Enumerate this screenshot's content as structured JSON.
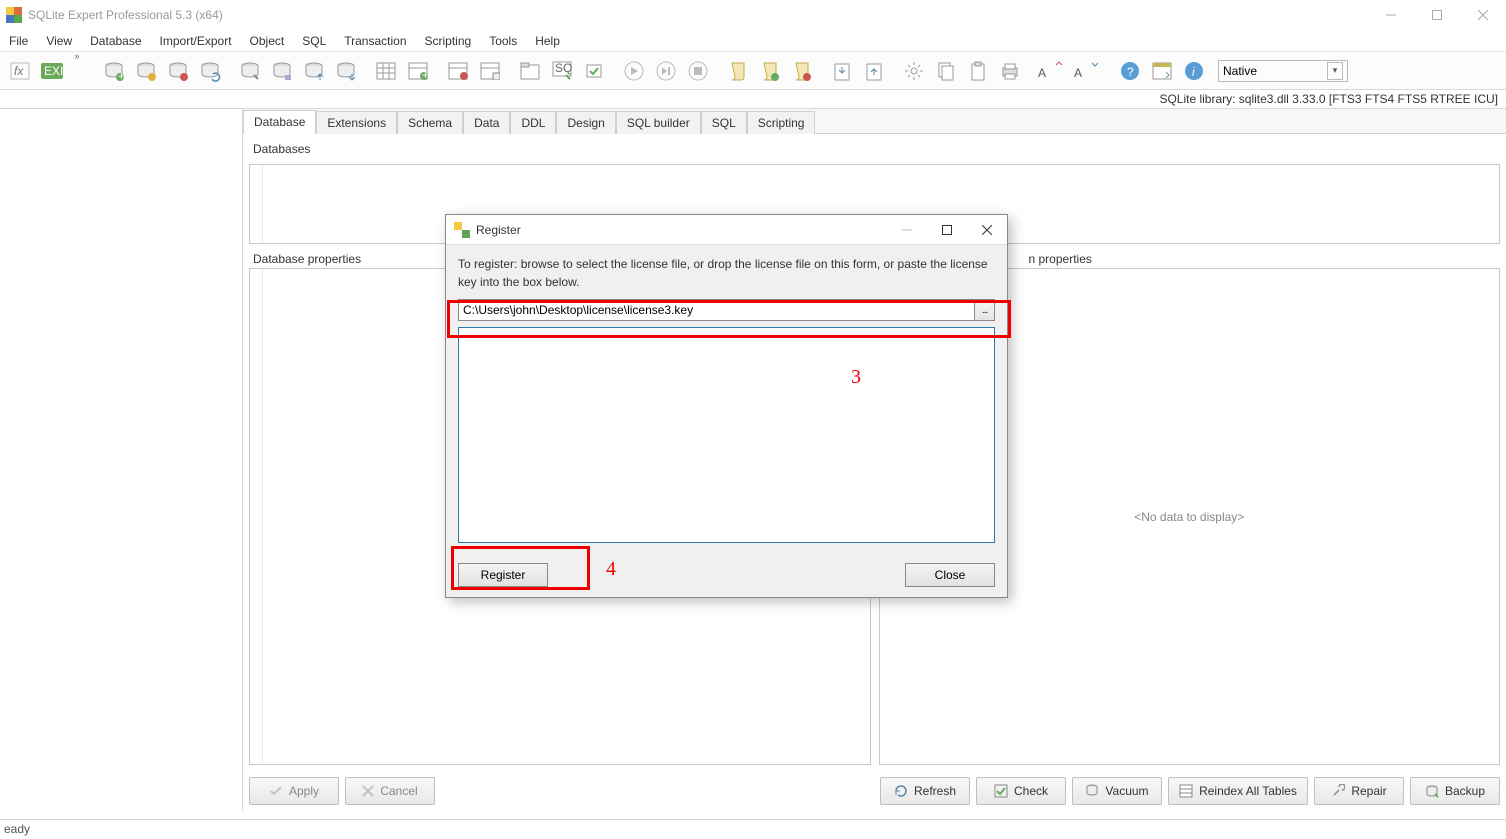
{
  "app": {
    "title": "SQLite Expert Professional 5.3 (x64)"
  },
  "menu": [
    "File",
    "View",
    "Database",
    "Import/Export",
    "Object",
    "SQL",
    "Transaction",
    "Scripting",
    "Tools",
    "Help"
  ],
  "toolbar": {
    "combo_value": "Native"
  },
  "status_library": "SQLite library: sqlite3.dll 3.33.0 [FTS3 FTS4 FTS5 RTREE ICU]",
  "tabs": [
    "Database",
    "Extensions",
    "Schema",
    "Data",
    "DDL",
    "Design",
    "SQL builder",
    "SQL",
    "Scripting"
  ],
  "panels": {
    "databases_label": "Databases",
    "db_props_label": "Database properties",
    "conn_props_label": "n properties",
    "no_data": "<No data to display>"
  },
  "footer_buttons": {
    "apply": "Apply",
    "cancel": "Cancel",
    "refresh": "Refresh",
    "check": "Check",
    "vacuum": "Vacuum",
    "reindex": "Reindex All Tables",
    "repair": "Repair",
    "backup": "Backup"
  },
  "statusbar": "eady",
  "dialog": {
    "title": "Register",
    "instruction": "To register: browse to select the license file, or drop the license file on this form, or paste the license key into the box below.",
    "path": "C:\\Users\\john\\Desktop\\license\\license3.key",
    "browse": "...",
    "register_btn": "Register",
    "close_btn": "Close"
  },
  "annotations": {
    "num3": "3",
    "num4": "4"
  }
}
